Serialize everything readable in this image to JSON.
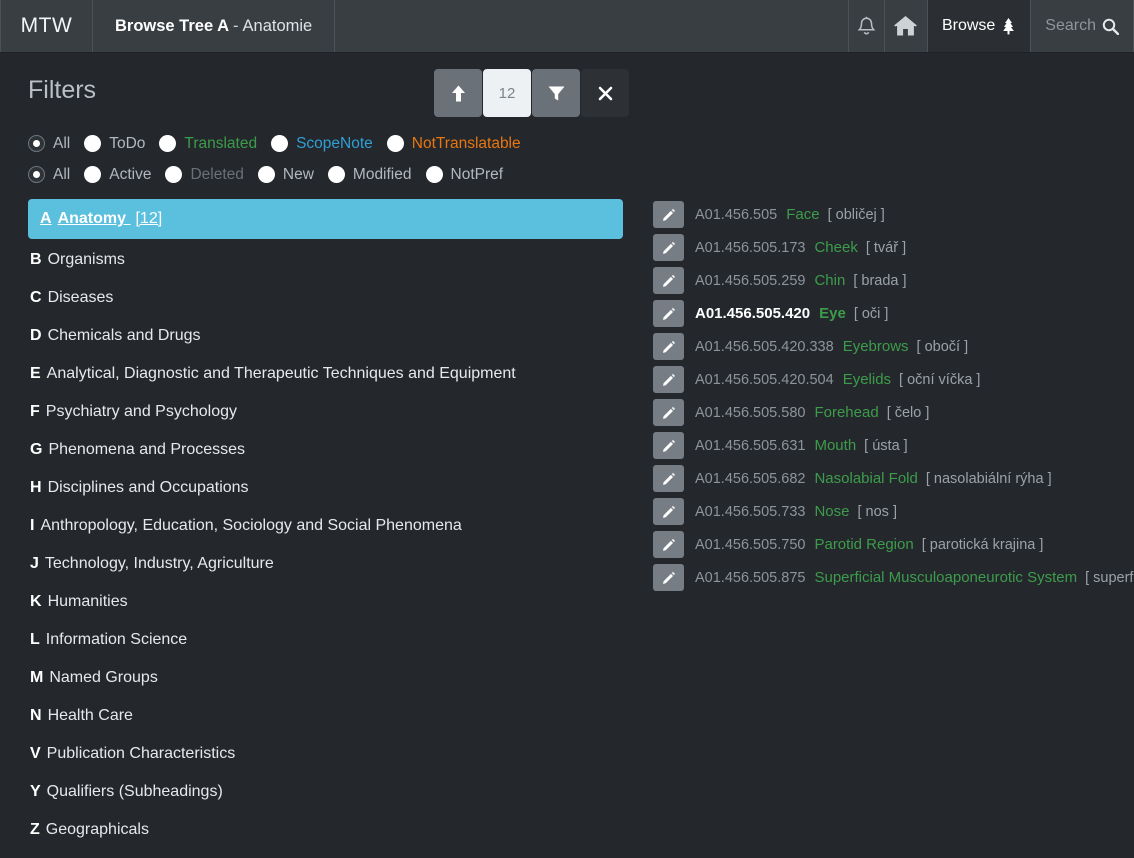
{
  "header": {
    "brand": "MTW",
    "breadcrumb": {
      "main": "Browse Tree A",
      "separator": "-",
      "sub": "Anatomie"
    },
    "icons": {
      "bell": "bell-icon",
      "home": "home-icon"
    },
    "tabs": [
      {
        "label": "Browse",
        "glyph": "evergreen-tree-icon",
        "active": true
      },
      {
        "label": "Search",
        "glyph": "magnifier-icon",
        "active": false
      }
    ]
  },
  "filters": {
    "title": "Filters",
    "toolbar": {
      "scroll_up_label": "up-arrow",
      "count": "12",
      "funnel_label": "filter-funnel",
      "close_label": "×"
    },
    "row1": [
      {
        "label": "All",
        "selected": true,
        "style": ""
      },
      {
        "label": "ToDo",
        "selected": false,
        "style": ""
      },
      {
        "label": "Translated",
        "selected": false,
        "style": "green"
      },
      {
        "label": "ScopeNote",
        "selected": false,
        "style": "blue"
      },
      {
        "label": "NotTranslatable",
        "selected": false,
        "style": "orange"
      }
    ],
    "row2": [
      {
        "label": "All",
        "selected": true,
        "style": ""
      },
      {
        "label": "Active",
        "selected": false,
        "style": ""
      },
      {
        "label": "Deleted",
        "selected": false,
        "style": "dim"
      },
      {
        "label": "New",
        "selected": false,
        "style": ""
      },
      {
        "label": "Modified",
        "selected": false,
        "style": ""
      },
      {
        "label": "NotPref",
        "selected": false,
        "style": ""
      }
    ]
  },
  "tree": [
    {
      "letter": "A",
      "label": "Anatomy",
      "count": "[12]",
      "active": true
    },
    {
      "letter": "B",
      "label": "Organisms",
      "count": "",
      "active": false
    },
    {
      "letter": "C",
      "label": "Diseases",
      "count": "",
      "active": false
    },
    {
      "letter": "D",
      "label": "Chemicals and Drugs",
      "count": "",
      "active": false
    },
    {
      "letter": "E",
      "label": "Analytical, Diagnostic and Therapeutic Techniques and Equipment",
      "count": "",
      "active": false
    },
    {
      "letter": "F",
      "label": "Psychiatry and Psychology",
      "count": "",
      "active": false
    },
    {
      "letter": "G",
      "label": "Phenomena and Processes",
      "count": "",
      "active": false
    },
    {
      "letter": "H",
      "label": "Disciplines and Occupations",
      "count": "",
      "active": false
    },
    {
      "letter": "I",
      "label": "Anthropology, Education, Sociology and Social Phenomena",
      "count": "",
      "active": false
    },
    {
      "letter": "J",
      "label": "Technology, Industry, Agriculture",
      "count": "",
      "active": false
    },
    {
      "letter": "K",
      "label": "Humanities",
      "count": "",
      "active": false
    },
    {
      "letter": "L",
      "label": "Information Science",
      "count": "",
      "active": false
    },
    {
      "letter": "M",
      "label": "Named Groups",
      "count": "",
      "active": false
    },
    {
      "letter": "N",
      "label": "Health Care",
      "count": "",
      "active": false
    },
    {
      "letter": "V",
      "label": "Publication Characteristics",
      "count": "",
      "active": false
    },
    {
      "letter": "Y",
      "label": "Qualifiers (Subheadings)",
      "count": "",
      "active": false
    },
    {
      "letter": "Z",
      "label": "Geographicals",
      "count": "",
      "active": false
    }
  ],
  "terms": [
    {
      "code": "A01.456.505",
      "term": "Face",
      "translation": "[ obličej ]",
      "current": false
    },
    {
      "code": "A01.456.505.173",
      "term": "Cheek",
      "translation": "[ tvář ]",
      "current": false
    },
    {
      "code": "A01.456.505.259",
      "term": "Chin",
      "translation": "[ brada ]",
      "current": false
    },
    {
      "code": "A01.456.505.420",
      "term": "Eye",
      "translation": "[ oči ]",
      "current": true
    },
    {
      "code": "A01.456.505.420.338",
      "term": "Eyebrows",
      "translation": "[ obočí ]",
      "current": false
    },
    {
      "code": "A01.456.505.420.504",
      "term": "Eyelids",
      "translation": "[ oční víčka ]",
      "current": false
    },
    {
      "code": "A01.456.505.580",
      "term": "Forehead",
      "translation": "[ čelo ]",
      "current": false
    },
    {
      "code": "A01.456.505.631",
      "term": "Mouth",
      "translation": "[ ústa ]",
      "current": false
    },
    {
      "code": "A01.456.505.682",
      "term": "Nasolabial Fold",
      "translation": "[ nasolabiální rýha ]",
      "current": false
    },
    {
      "code": "A01.456.505.733",
      "term": "Nose",
      "translation": "[ nos ]",
      "current": false
    },
    {
      "code": "A01.456.505.750",
      "term": "Parotid Region",
      "translation": "[ parotická krajina ]",
      "current": false
    },
    {
      "code": "A01.456.505.875",
      "term": "Superficial Musculoaponeurotic System",
      "translation": "[ superficiální muskuloaponeurotický systém ]",
      "current": false
    }
  ],
  "colors": {
    "accent_highlight": "#5bc0de",
    "green": "#3d9c4b",
    "blue": "#2f9fd4",
    "orange": "#e8760f",
    "header_bg": "#393e43",
    "body_bg": "#24282c"
  }
}
